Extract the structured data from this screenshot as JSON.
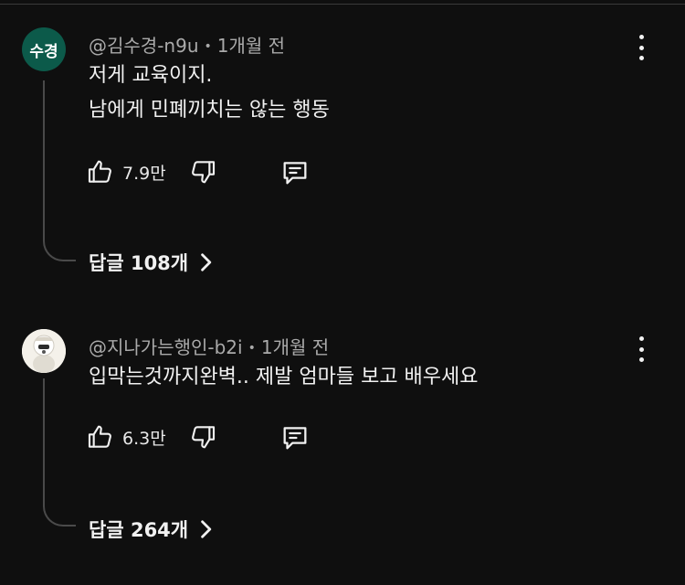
{
  "comments": [
    {
      "avatar_text": "수경",
      "avatar_color": "#0c5a4a",
      "author": "@김수경-n9u",
      "time": "1개월 전",
      "text_lines": [
        "저게 교육이지.",
        "남에게 민폐끼치는 않는 행동"
      ],
      "likes": "7.9만",
      "replies": "답글 108개"
    },
    {
      "avatar_text": "",
      "author": "@지나가는행인-b2i",
      "time": "1개월 전",
      "text_lines": [
        "입막는것까지완벽.. 제발 엄마들 보고 배우세요"
      ],
      "likes": "6.3만",
      "replies": "답글 264개"
    }
  ],
  "icons": {
    "like": "thumbs-up-icon",
    "dislike": "thumbs-down-icon",
    "reply": "comment-icon",
    "more": "more-vert-icon",
    "expand": "chevron-right-icon"
  },
  "colors": {
    "background": "#0f0f0f",
    "text": "#f1f1f1",
    "meta": "#aaaaaa"
  }
}
